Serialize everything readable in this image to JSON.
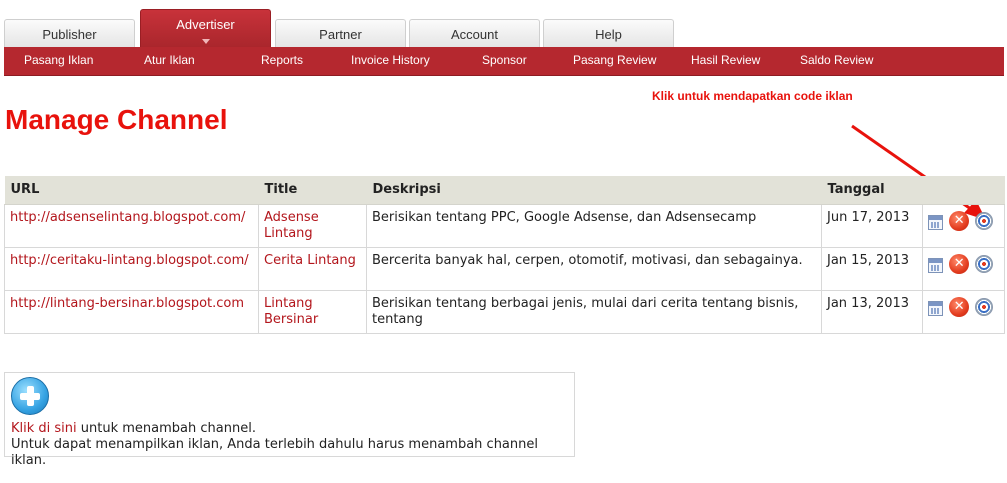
{
  "tabs": [
    {
      "label": "Publisher",
      "active": false
    },
    {
      "label": "Advertiser",
      "active": true
    },
    {
      "label": "Partner",
      "active": false
    },
    {
      "label": "Account",
      "active": false
    },
    {
      "label": "Help",
      "active": false
    }
  ],
  "subnav": [
    "Pasang Iklan",
    "Atur Iklan",
    "Reports",
    "Invoice History",
    "Sponsor",
    "Pasang Review",
    "Hasil Review",
    "Saldo Review"
  ],
  "annotation": "Klik untuk mendapatkan code iklan",
  "page_title": "Manage Channel",
  "table": {
    "headers": {
      "url": "URL",
      "title": "Title",
      "desc": "Deskripsi",
      "date": "Tanggal",
      "actions": ""
    },
    "rows": [
      {
        "url": "http://adsenselintang.blogspot.com/",
        "title": "Adsense Lintang",
        "desc": "Berisikan tentang PPC, Google Adsense, dan Adsensecamp",
        "date": "Jun 17, 2013"
      },
      {
        "url": "http://ceritaku-lintang.blogspot.com/",
        "title": "Cerita Lintang",
        "desc": "Bercerita banyak hal, cerpen, otomotif, motivasi, dan sebagainya.",
        "date": "Jan 15, 2013"
      },
      {
        "url": "http://lintang-bersinar.blogspot.com",
        "title": "Lintang Bersinar",
        "desc": "Berisikan tentang berbagai jenis, mulai dari cerita tentang bisnis, tentang",
        "date": "Jan 13, 2013"
      }
    ],
    "icons": {
      "edit": "calendar-icon",
      "delete": "delete-icon",
      "code": "target-icon",
      "delete_glyph": "✕"
    }
  },
  "add_channel": {
    "link_text": "Klik di sini",
    "link_suffix": " untuk menambah channel.",
    "note": "Untuk dapat menampilkan iklan, Anda terlebih dahulu harus menambah channel iklan."
  },
  "colors": {
    "accent": "#b5282f",
    "title_red": "#e8120c",
    "link_red": "#b3161c"
  }
}
